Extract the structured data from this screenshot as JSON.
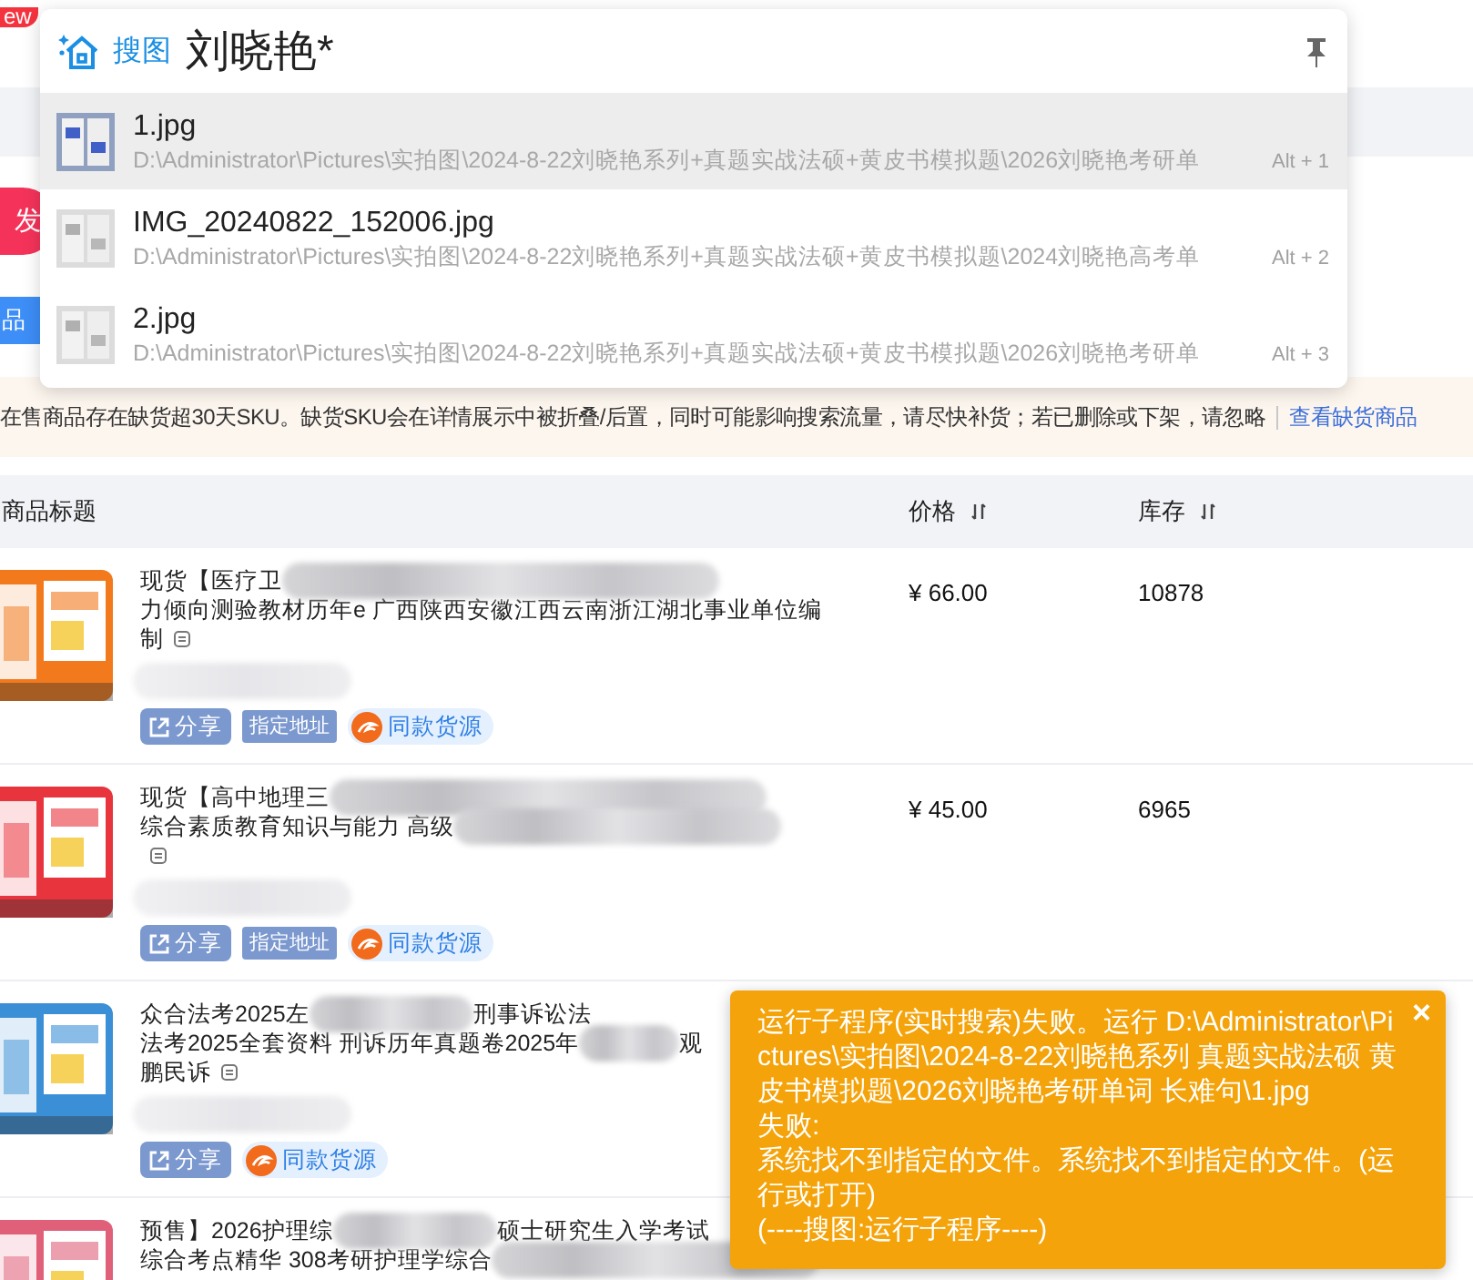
{
  "background": {
    "badge": "ew",
    "publish_button": "发",
    "category_button": "品"
  },
  "notice": {
    "text": "在售商品存在缺货超30天SKU。缺货SKU会在详情展示中被折叠/后置，同时可能影响搜索流量，请尽快补货；若已删除或下架，请忽略",
    "link": "查看缺货商品"
  },
  "table": {
    "columns": [
      {
        "label": "商品标题",
        "sortable": false
      },
      {
        "label": "价格",
        "sortable": true
      },
      {
        "label": "库存",
        "sortable": true
      }
    ],
    "rows": [
      {
        "title_lines": [
          [
            {
              "kind": "text",
              "text": "现货【医疗卫"
            },
            {
              "kind": "blur"
            }
          ],
          [
            {
              "kind": "text",
              "text": "力倾向测验教材历年e 广西陕西安徽江西云南浙江湖北事业单位编"
            }
          ],
          [
            {
              "kind": "text",
              "text": "制"
            },
            {
              "kind": "note"
            }
          ]
        ],
        "price": "¥ 66.00",
        "stock": "10878",
        "tags": [
          {
            "kind": "share",
            "label": "分享"
          },
          {
            "kind": "address",
            "label": "指定地址"
          },
          {
            "kind": "source",
            "label": "同款货源"
          }
        ]
      },
      {
        "title_lines": [
          [
            {
              "kind": "text",
              "text": "现货【高中地理三"
            },
            {
              "kind": "blur"
            }
          ],
          [
            {
              "kind": "text",
              "text": "综合素质教育知识与能力 高级"
            },
            {
              "kind": "blur"
            }
          ],
          [
            {
              "kind": "note"
            }
          ]
        ],
        "price": "¥ 45.00",
        "stock": "6965",
        "tags": [
          {
            "kind": "share",
            "label": "分享"
          },
          {
            "kind": "address",
            "label": "指定地址"
          },
          {
            "kind": "source",
            "label": "同款货源"
          }
        ]
      },
      {
        "title_lines": [
          [
            {
              "kind": "text",
              "text": "众合法考2025左"
            },
            {
              "kind": "blur"
            },
            {
              "kind": "text",
              "text": "刑事诉讼法"
            }
          ],
          [
            {
              "kind": "text",
              "text": "法考2025全套资料 刑诉历年真题卷2025年"
            },
            {
              "kind": "blur"
            },
            {
              "kind": "text",
              "text": "观"
            }
          ],
          [
            {
              "kind": "text",
              "text": "鹏民诉"
            },
            {
              "kind": "note"
            }
          ]
        ],
        "tags": [
          {
            "kind": "share",
            "label": "分享"
          },
          {
            "kind": "source",
            "label": "同款货源"
          }
        ]
      },
      {
        "title_lines": [
          [
            {
              "kind": "text",
              "text": "预售】2026护理综"
            },
            {
              "kind": "blur"
            },
            {
              "kind": "text",
              "text": "硕士研究生入学考试"
            }
          ],
          [
            {
              "kind": "text",
              "text": "综合考点精华 308考研护理学综合"
            },
            {
              "kind": "blur"
            }
          ]
        ],
        "tags": []
      }
    ]
  },
  "search_popup": {
    "brand": "搜图",
    "query": "刘晓艳*",
    "results": [
      {
        "name": "1.jpg",
        "path": "D:\\Administrator\\Pictures\\实拍图\\2024-8-22刘晓艳系列+真题实战法硕+黄皮书模拟题\\2026刘晓艳考研单",
        "shortcut": "Alt + 1",
        "selected": true
      },
      {
        "name": "IMG_20240822_152006.jpg",
        "path": "D:\\Administrator\\Pictures\\实拍图\\2024-8-22刘晓艳系列+真题实战法硕+黄皮书模拟题\\2024刘晓艳高考单",
        "shortcut": "Alt + 2",
        "selected": false
      },
      {
        "name": "2.jpg",
        "path": "D:\\Administrator\\Pictures\\实拍图\\2024-8-22刘晓艳系列+真题实战法硕+黄皮书模拟题\\2026刘晓艳考研单",
        "shortcut": "Alt + 3",
        "selected": false
      }
    ]
  },
  "toast": {
    "close": "×",
    "paragraphs": [
      "运行子程序(实时搜索)失败。运行 D:\\Administrator\\Pictures\\实拍图\\2024-8-22刘晓艳系列 真题实战法硕 黄皮书模拟题\\2026刘晓艳考研单词 长难句\\1.jpg",
      "失败:",
      "系统找不到指定的文件。系统找不到指定的文件。(运行或打开)",
      "(----搜图:运行子程序----)"
    ]
  }
}
